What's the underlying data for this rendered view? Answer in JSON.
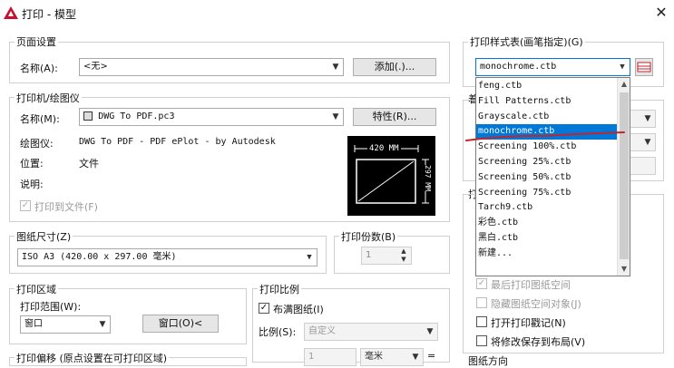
{
  "window": {
    "title": "打印 - 模型"
  },
  "page_setup": {
    "group_label": "页面设置",
    "name_label": "名称(A):",
    "name_value": "<无>",
    "add_button": "添加(.)..."
  },
  "printer": {
    "group_label": "打印机/绘图仪",
    "name_label": "名称(M):",
    "name_value": "DWG To PDF.pc3",
    "properties_button": "特性(R)...",
    "plotter_label": "绘图仪:",
    "plotter_value": "DWG To PDF - PDF ePlot - by Autodesk",
    "location_label": "位置:",
    "location_value": "文件",
    "description_label": "说明:",
    "print_to_file_label": "打印到文件(F)",
    "preview_width": "420 MM",
    "preview_height": "297 MM"
  },
  "paper_size": {
    "group_label": "图纸尺寸(Z)",
    "value": "ISO A3 (420.00 x 297.00 毫米)"
  },
  "copies": {
    "group_label": "打印份数(B)",
    "value": "1"
  },
  "plot_area": {
    "group_label": "打印区域",
    "range_label": "打印范围(W):",
    "range_value": "窗口",
    "window_button": "窗口(O)<"
  },
  "plot_scale": {
    "group_label": "打印比例",
    "fit_label": "布满图纸(I)",
    "scale_label": "比例(S):",
    "scale_value": "自定义",
    "unit_value": "毫米",
    "amount_value": "1"
  },
  "plot_offset": {
    "group_label": "打印偏移 (原点设置在可打印区域)"
  },
  "style_table": {
    "group_label": "打印样式表(画笔指定)(G)",
    "selected_value": "monochrome.ctb",
    "options": [
      "feng.ctb",
      "Fill Patterns.ctb",
      "Grayscale.ctb",
      "monochrome.ctb",
      "Screening 100%.ctb",
      "Screening 25%.ctb",
      "Screening 50%.ctb",
      "Screening 75%.ctb",
      "Tarch9.ctb",
      "彩色.ctb",
      "黑白.ctb",
      "新建..."
    ]
  },
  "right_partial": {
    "shaded_label_partial": "着",
    "options_label_partial": "打",
    "bottom_label_partial": "图纸方向"
  },
  "plot_options": {
    "last_plot_space_label": "最后打印图纸空间",
    "hide_objects_label": "隐藏图纸空间对象(J)",
    "stamp_label": "打开打印戳记(N)",
    "save_changes_label": "将修改保存到布局(V)"
  },
  "colors": {
    "accent": "#0078d7",
    "annotation_red": "#c0262c"
  }
}
